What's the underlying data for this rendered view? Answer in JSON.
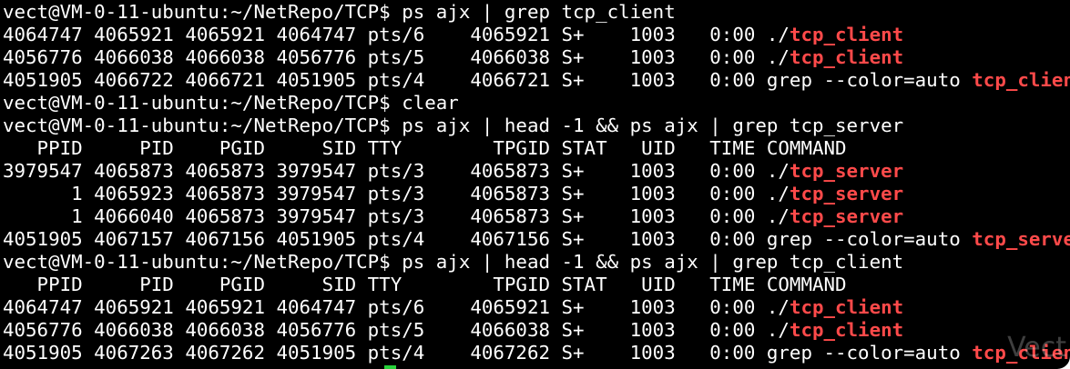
{
  "terminal": {
    "lines": [
      {
        "text": "vect@VM-0-11-ubuntu:~/NetRepo/TCP$ ps ajx | grep tcp_client",
        "hl": ""
      },
      {
        "text": "4064747 4065921 4065921 4064747 pts/6    4065921 S+    1003   0:00 ./",
        "hl": "tcp_client"
      },
      {
        "text": "4056776 4066038 4066038 4056776 pts/5    4066038 S+    1003   0:00 ./",
        "hl": "tcp_client"
      },
      {
        "text": "4051905 4066722 4066721 4051905 pts/4    4066721 S+    1003   0:00 grep --color=auto ",
        "hl": "tcp_client"
      },
      {
        "text": "vect@VM-0-11-ubuntu:~/NetRepo/TCP$ clear",
        "hl": ""
      },
      {
        "text": "vect@VM-0-11-ubuntu:~/NetRepo/TCP$ ps ajx | head -1 && ps ajx | grep tcp_server",
        "hl": ""
      },
      {
        "text": "   PPID     PID    PGID     SID TTY        TPGID STAT   UID   TIME COMMAND",
        "hl": ""
      },
      {
        "text": "3979547 4065873 4065873 3979547 pts/3    4065873 S+    1003   0:00 ./",
        "hl": "tcp_server"
      },
      {
        "text": "      1 4065923 4065873 3979547 pts/3    4065873 S+    1003   0:00 ./",
        "hl": "tcp_server"
      },
      {
        "text": "      1 4066040 4065873 3979547 pts/3    4065873 S+    1003   0:00 ./",
        "hl": "tcp_server"
      },
      {
        "text": "4051905 4067157 4067156 4051905 pts/4    4067156 S+    1003   0:00 grep --color=auto ",
        "hl": "tcp_server"
      },
      {
        "text": "vect@VM-0-11-ubuntu:~/NetRepo/TCP$ ps ajx | head -1 && ps ajx | grep tcp_client",
        "hl": ""
      },
      {
        "text": "   PPID     PID    PGID     SID TTY        TPGID STAT   UID   TIME COMMAND",
        "hl": ""
      },
      {
        "text": "4064747 4065921 4065921 4064747 pts/6    4065921 S+    1003   0:00 ./",
        "hl": "tcp_client"
      },
      {
        "text": "4056776 4066038 4066038 4056776 pts/5    4066038 S+    1003   0:00 ./",
        "hl": "tcp_client"
      },
      {
        "text": "4051905 4067263 4067262 4051905 pts/4    4067262 S+    1003   0:00 grep --color=auto ",
        "hl": "tcp_client"
      }
    ],
    "watermark": "Vect",
    "colors": {
      "background": "#000000",
      "text": "#ffffff",
      "match_highlight": "#ff4a4a",
      "cursor": "#27d23a"
    }
  }
}
